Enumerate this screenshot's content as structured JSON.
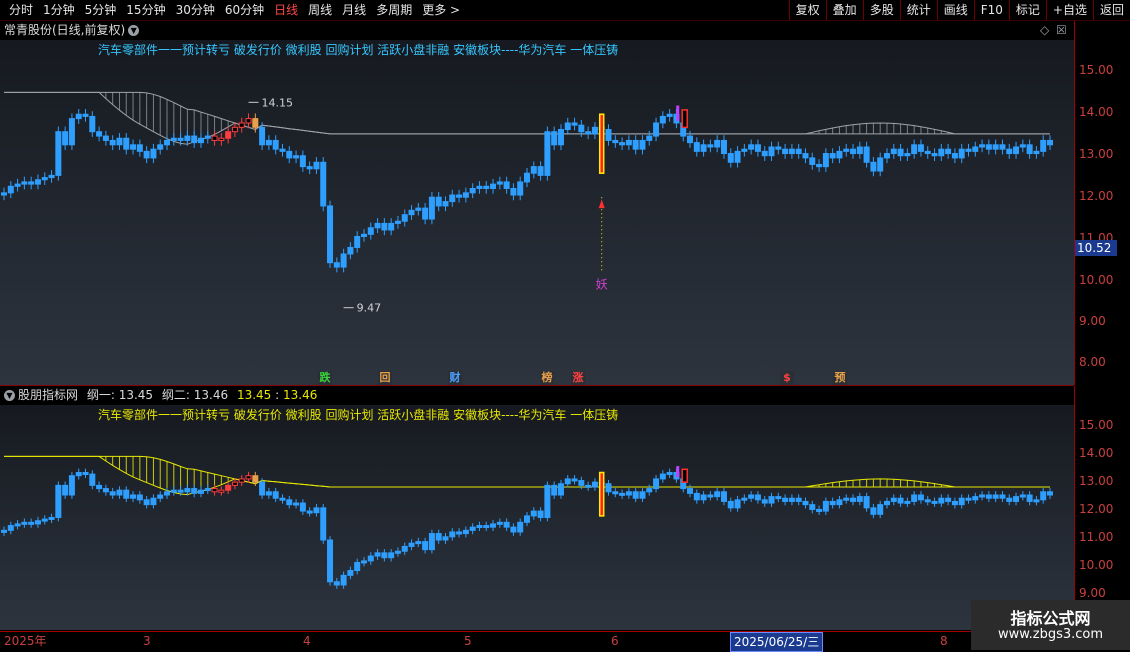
{
  "toolbar": {
    "periods": [
      "分时",
      "1分钟",
      "5分钟",
      "15分钟",
      "30分钟",
      "60分钟",
      "日线",
      "周线",
      "月线",
      "多周期",
      "更多 >"
    ],
    "selected_period": "日线",
    "buttons": [
      "复权",
      "叠加",
      "多股",
      "统计",
      "画线",
      "F10",
      "标记",
      "+自选",
      "返回"
    ]
  },
  "pane1": {
    "title": "常青股份(日线,前复权)",
    "news": "汽车零部件一一预计转亏 破发行价 微利股 回购计划 活跃小盘非融 安徽板块----华为汽车 一体压铸",
    "high_label": "14.15",
    "low_label": "9.47",
    "signal_label": "妖",
    "current_price": "10.52",
    "y_ticks": [
      "15.00",
      "14.00",
      "13.00",
      "12.00",
      "11.00",
      "10.00",
      "9.00",
      "8.00"
    ],
    "events": [
      {
        "text": "跌",
        "color": "#38d33a"
      },
      {
        "text": "回",
        "color": "#e8a04a"
      },
      {
        "text": "财",
        "color": "#4aa0ff"
      },
      {
        "text": "榜",
        "color": "#e8a04a"
      },
      {
        "text": "涨",
        "color": "#ff4040"
      },
      {
        "text": "$",
        "color": "#ff4040"
      },
      {
        "text": "预",
        "color": "#e8a04a"
      }
    ]
  },
  "pane2": {
    "title": "股朋指标网",
    "line1_label": "纲一: 13.45",
    "line2_label": "纲二: 13.46",
    "value1": "13.45",
    "value2": "13.46",
    "news": "汽车零部件一一预计转亏 破发行价 微利股 回购计划 活跃小盘非融 安徽板块----华为汽车 一体压铸",
    "y_ticks": [
      "15.00",
      "14.00",
      "13.00",
      "12.00",
      "11.00",
      "10.00",
      "9.00"
    ]
  },
  "xaxis": {
    "labels": [
      "2025年",
      "3",
      "4",
      "5",
      "6",
      "2025/06/25/三",
      "8"
    ],
    "current_label": "2025/06/25/三"
  },
  "watermark": {
    "line1": "指标公式网",
    "line2": "www.zbgs3.com"
  },
  "colors": {
    "up": "#ff3d3d",
    "down": "#2e9fff",
    "border": "#a30000",
    "ma_line": "#a0a4aa",
    "yellow": "#e8e800"
  },
  "chart_data": {
    "type": "candlestick",
    "closes": [
      12.1,
      12.25,
      12.3,
      12.35,
      12.3,
      12.4,
      12.45,
      12.5,
      13.5,
      13.2,
      13.8,
      13.9,
      13.85,
      13.5,
      13.4,
      13.3,
      13.2,
      13.35,
      13.1,
      13.2,
      13.05,
      12.9,
      13.1,
      13.2,
      13.3,
      13.35,
      13.3,
      13.4,
      13.25,
      13.35,
      13.4,
      13.3,
      13.35,
      13.5,
      13.6,
      13.7,
      13.8,
      13.6,
      13.2,
      13.3,
      13.1,
      13.05,
      12.9,
      12.95,
      12.7,
      12.65,
      12.8,
      11.8,
      10.5,
      10.4,
      10.7,
      10.85,
      11.1,
      11.15,
      11.3,
      11.4,
      11.25,
      11.4,
      11.45,
      11.6,
      11.7,
      11.75,
      11.5,
      12.0,
      11.8,
      11.9,
      12.05,
      12.0,
      12.1,
      12.2,
      12.25,
      12.2,
      12.3,
      12.35,
      12.2,
      12.05,
      12.35,
      12.55,
      12.7,
      12.5,
      13.5,
      13.2,
      13.55,
      13.7,
      13.65,
      13.5,
      13.45,
      13.6,
      13.55,
      13.3,
      13.25,
      13.2,
      13.3,
      13.1,
      13.3,
      13.4,
      13.7,
      13.85,
      13.9,
      13.7,
      13.4,
      13.25,
      13.05,
      13.2,
      13.15,
      13.3,
      13.0,
      12.8,
      13.05,
      13.1,
      13.2,
      13.05,
      12.95,
      13.15,
      13.1,
      13.0,
      13.1,
      13.0,
      12.9,
      12.75,
      12.7,
      13.0,
      12.9,
      13.05,
      13.1,
      13.0,
      13.15,
      12.8,
      12.6,
      12.9,
      13.0,
      13.1,
      12.95,
      13.0,
      13.2,
      13.05,
      13.0,
      12.95,
      13.1,
      13.0,
      12.9,
      13.1,
      13.05,
      13.15,
      13.2,
      13.1,
      13.2,
      13.1,
      13.0,
      13.15,
      13.2,
      13.0,
      13.05,
      13.3,
      13.2
    ],
    "high": 14.15,
    "low": 9.47,
    "ma_level": 13.45,
    "ylim": [
      7.7,
      15.6
    ]
  }
}
